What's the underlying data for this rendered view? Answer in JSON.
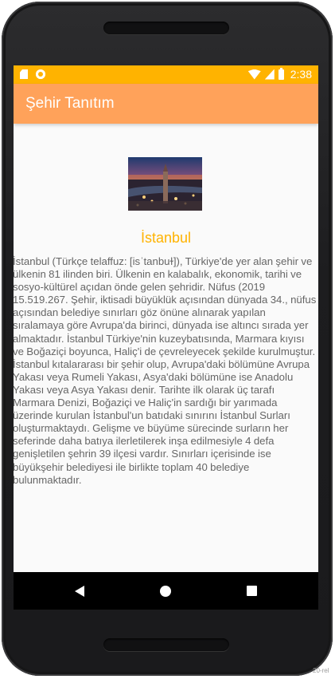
{
  "status_bar": {
    "time": "2:38",
    "icons": [
      "sd-card-icon",
      "notification-circle-icon",
      "wifi-icon",
      "signal-icon",
      "battery-icon"
    ]
  },
  "app_bar": {
    "title": "Şehir Tanıtım",
    "color": "#FFA25A"
  },
  "content": {
    "image_semantic": "istanbul-city-photo",
    "city_name": "İstanbul",
    "city_name_color": "#FFB300",
    "description": "İstanbul (Türkçe telaffuz: [isˈtanbuɫ]), Türkiye'de yer alan şehir ve ülkenin 81 ilinden biri. Ülkenin en kalabalık, ekonomik, tarihi ve sosyo-kültürel açıdan önde gelen şehridir. Nüfus (2019 15.519.267.  Şehir, iktisadi büyüklük açısından dünyada 34., nüfus açısından belediye sınırları göz önüne alınarak yapılan sıralamaya göre Avrupa'da birinci, dünyada ise altıncı sırada yer almaktadır. İstanbul Türkiye'nin kuzeybatısında, Marmara kıyısı ve Boğaziçi boyunca, Haliç'i de çevreleyecek şekilde kurulmuştur. İstanbul kıtalararası bir şehir olup, Avrupa'daki bölümüne Avrupa Yakası veya Rumeli Yakası, Asya'daki bölümüne ise Anadolu Yakası veya Asya Yakası denir. Tarihte ilk olarak üç tarafı Marmara Denizi, Boğaziçi ve Haliç'in sardığı bir yarımada üzerinde kurulan İstanbul'un batıdaki sınırını İstanbul Surları oluşturmaktaydı. Gelişme ve büyüme sürecinde surların her seferinde daha batıya ilerletilerek inşa edilmesiyle 4 defa genişletilen şehrin 39 ilçesi vardır. Sınırları içerisinde ise büyükşehir belediyesi ile birlikte toplam 40 belediye bulunmaktadır."
  },
  "nav_bar": {
    "buttons": [
      "back-icon",
      "home-icon",
      "recents-icon"
    ]
  },
  "colors": {
    "status_bar": "#FFB300",
    "app_bar": "#FFA25A",
    "screen_bg": "#FAFAFA",
    "text": "#666666"
  },
  "watermark": "20-rel"
}
